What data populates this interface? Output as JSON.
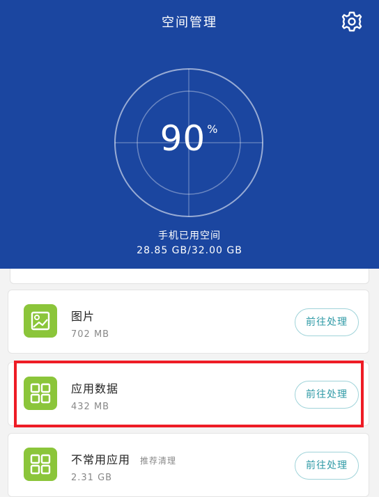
{
  "header": {
    "title": "空间管理",
    "percent": "90",
    "percent_sign": "%",
    "used_label": "手机已用空间",
    "used_value": "28.85 GB/32.00 GB"
  },
  "items": [
    {
      "name": "图片",
      "size": "702 MB",
      "icon": "image-icon",
      "button": "前往处理"
    },
    {
      "name": "应用数据",
      "size": "432 MB",
      "icon": "grid-icon",
      "button": "前往处理"
    },
    {
      "name": "不常用应用",
      "tag": "推荐清理",
      "size": "2.31 GB",
      "icon": "grid-icon",
      "button": "前往处理"
    }
  ],
  "colors": {
    "header_bg": "#1b46a0",
    "icon_green": "#8bc53a",
    "button_text": "#2f9aa6",
    "highlight": "#ee1c25"
  }
}
